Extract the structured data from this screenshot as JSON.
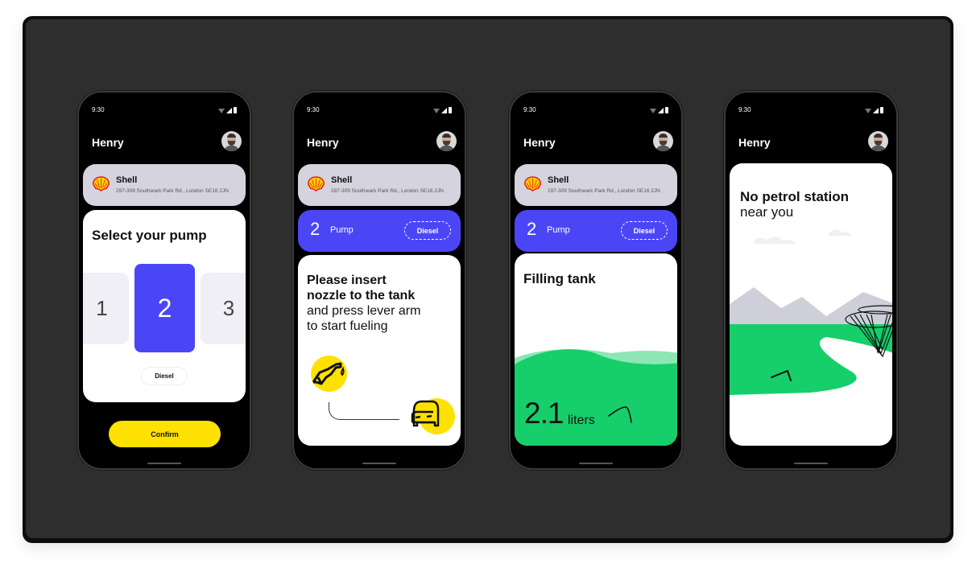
{
  "colors": {
    "accent_blue": "#4b46f5",
    "accent_yellow": "#ffe100",
    "fill_green": "#16cf6a",
    "card_grey": "#d4d3de",
    "stage_bg": "#2e2e2e"
  },
  "common": {
    "time": "9:30",
    "user_name": "Henry",
    "status_icons": [
      "wifi-icon",
      "signal-icon",
      "battery-icon"
    ],
    "station": {
      "brand_icon": "shell-logo-icon",
      "name": "Shell",
      "address": "297-309 Southwark Park Rd., London SE16 2JN"
    }
  },
  "screens": [
    {
      "id": "select-pump",
      "title": "Select your pump",
      "pumps": [
        "1",
        "2",
        "3"
      ],
      "selected_pump": "2",
      "fuel_type": "Diesel",
      "confirm_label": "Confirm"
    },
    {
      "id": "insert-nozzle",
      "pump_number": "2",
      "pump_label": "Pump",
      "fuel_type": "Diesel",
      "instruction_bold_1": "Please insert",
      "instruction_bold_2": "nozzle to the tank",
      "instruction_regular_1": "and press lever arm",
      "instruction_regular_2": "to start fueling",
      "icons": [
        "fuel-nozzle-icon",
        "car-icon"
      ]
    },
    {
      "id": "filling-tank",
      "pump_number": "2",
      "pump_label": "Pump",
      "fuel_type": "Diesel",
      "title": "Filling tank",
      "liters_value": "2.1",
      "liters_unit": "liters"
    },
    {
      "id": "no-station",
      "title_bold": "No petrol station",
      "title_regular": "near you"
    }
  ]
}
